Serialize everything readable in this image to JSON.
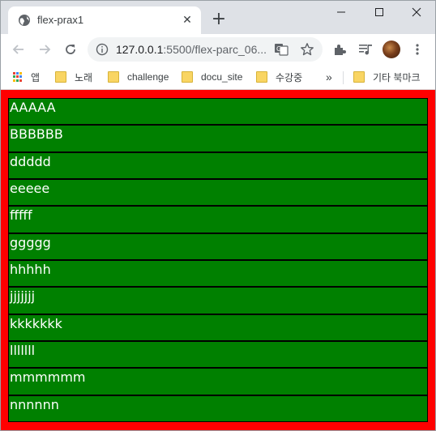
{
  "browser": {
    "tab": {
      "title": "flex-prax1",
      "close_glyph": "✕",
      "favicon": "globe-icon"
    },
    "new_tab_glyph": "+",
    "window_controls": [
      "minimize-icon",
      "maximize-icon",
      "close-icon"
    ],
    "toolbar": {
      "url_host": "127.0.0.1",
      "url_rest": ":5500/flex-parc_06...",
      "icons": [
        "back-icon",
        "forward-icon",
        "reload-icon",
        "info-icon",
        "translate-icon",
        "star-icon",
        "extensions-icon",
        "media-control-icon",
        "profile-avatar",
        "menu-icon"
      ]
    },
    "bookmarks": [
      {
        "label": "앱",
        "icon": "apps-icon"
      },
      {
        "label": "노래",
        "icon": "folder-icon"
      },
      {
        "label": "challenge",
        "icon": "folder-icon"
      },
      {
        "label": "docu_site",
        "icon": "folder-icon"
      },
      {
        "label": "수강중",
        "icon": "folder-icon"
      },
      {
        "label": "»",
        "icon": "more-chevron"
      },
      {
        "label": "기타 북마크",
        "icon": "folder-icon"
      }
    ]
  },
  "page": {
    "colors": {
      "container_bg": "#ff0000",
      "item_bg": "#008000",
      "item_border": "#000000",
      "item_text": "#ffffff"
    },
    "items": [
      "AAAAA",
      "BBBBBB",
      "ddddd",
      "eeeee",
      "fffff",
      "ggggg",
      "hhhhh",
      "jjjjjjj",
      "kkkkkkk",
      "lllllll",
      "mmmmmm",
      "nnnnnn"
    ]
  }
}
